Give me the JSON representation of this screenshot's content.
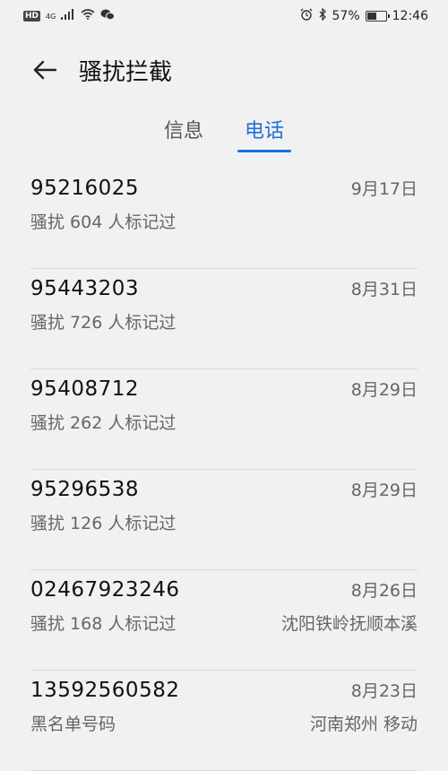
{
  "status_bar": {
    "hd": "HD",
    "network": "4G",
    "battery_percent": "57%",
    "battery_level": 0.57,
    "time": "12:46"
  },
  "header": {
    "title": "骚扰拦截"
  },
  "tabs": [
    {
      "label": "信息",
      "active": false
    },
    {
      "label": "电话",
      "active": true
    }
  ],
  "calls": [
    {
      "number": "95216025",
      "date": "9月17日",
      "desc": "骚扰  604 人标记过",
      "location": ""
    },
    {
      "number": "95443203",
      "date": "8月31日",
      "desc": "骚扰  726 人标记过",
      "location": ""
    },
    {
      "number": "95408712",
      "date": "8月29日",
      "desc": "骚扰  262 人标记过",
      "location": ""
    },
    {
      "number": "95296538",
      "date": "8月29日",
      "desc": "骚扰  126 人标记过",
      "location": ""
    },
    {
      "number": "02467923246",
      "date": "8月26日",
      "desc": "骚扰  168 人标记过",
      "location": "沈阳铁岭抚顺本溪"
    },
    {
      "number": "13592560582",
      "date": "8月23日",
      "desc": "黑名单号码",
      "location": "河南郑州 移动"
    }
  ],
  "colors": {
    "accent": "#1e6fe0",
    "background": "#f1f1f1"
  }
}
